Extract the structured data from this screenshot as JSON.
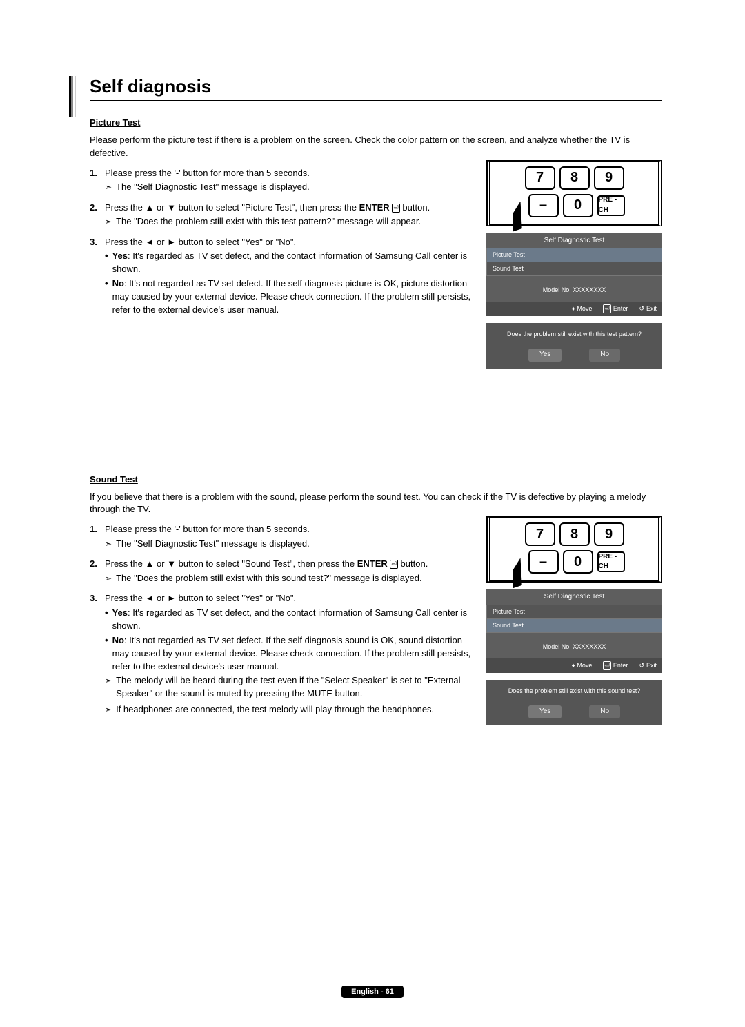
{
  "title": "Self diagnosis",
  "picture": {
    "heading": "Picture Test",
    "intro": "Please perform the picture test if there is a problem on the screen. Check the color pattern on the screen, and analyze whether the TV is defective.",
    "step1_text": "Please press the '-' button for more than 5 seconds.",
    "step1_sub": "The \"Self Diagnostic Test\" message is displayed.",
    "step2_pre": "Press the ▲ or ▼ button to select \"Picture Test\", then press the ",
    "step2_enter": "ENTER",
    "step2_post": " button.",
    "step2_sub": "The \"Does the problem still exist with this test pattern?\" message will appear.",
    "step3_text": "Press the ◄ or ► button to select \"Yes\" or \"No\".",
    "step3_yes_label": "Yes",
    "step3_yes_text": ": It's regarded as TV set defect, and the contact information of Samsung Call center is shown.",
    "step3_no_label": "No",
    "step3_no_text": ": It's not regarded as TV set defect. If the self diagnosis picture is OK, picture distortion may caused by your external device. Please check connection. If the problem still persists, refer to the external device's user manual."
  },
  "sound": {
    "heading": "Sound Test",
    "intro": "If you believe that there is a problem with the sound, please perform the sound test. You can check if the TV is defective by playing a melody through the TV.",
    "step1_text": "Please press the '-' button for more than 5 seconds.",
    "step1_sub": "The \"Self Diagnostic Test\" message is displayed.",
    "step2_pre": "Press the ▲ or ▼ button to select \"Sound Test\", then press the ",
    "step2_enter": "ENTER",
    "step2_post": " button.",
    "step2_sub": "The \"Does the problem still exist with this sound test?\" message is displayed.",
    "step3_text": "Press the ◄ or ► button to select \"Yes\" or \"No\".",
    "step3_yes_label": "Yes",
    "step3_yes_text": ": It's regarded as TV set defect, and the contact information of Samsung Call center is shown.",
    "step3_no_label": "No",
    "step3_no_text": ": It's not regarded as TV set defect. If the self diagnosis sound is OK, sound distortion may caused by your external device. Please check connection. If the problem still persists, refer to the external device's user manual.",
    "note1": "The melody will be heard during the test even if the \"Select Speaker\" is set to \"External Speaker\" or the sound is muted by pressing the MUTE button.",
    "note2": "If headphones are connected, the test melody will play through the headphones."
  },
  "remote": {
    "k7": "7",
    "k8": "8",
    "k9": "9",
    "minus": "–",
    "k0": "0",
    "prech": "PRE - CH"
  },
  "osd": {
    "title": "Self Diagnostic Test",
    "item1": "Picture Test",
    "item2": "Sound Test",
    "model": "Model No. XXXXXXXX",
    "move": "Move",
    "enter": "Enter",
    "exit": "Exit",
    "dlg_pic": "Does the problem still exist with this test pattern?",
    "dlg_snd": "Does the problem still exist with this sound test?",
    "yes": "Yes",
    "no": "No"
  },
  "footer": "English - 61"
}
